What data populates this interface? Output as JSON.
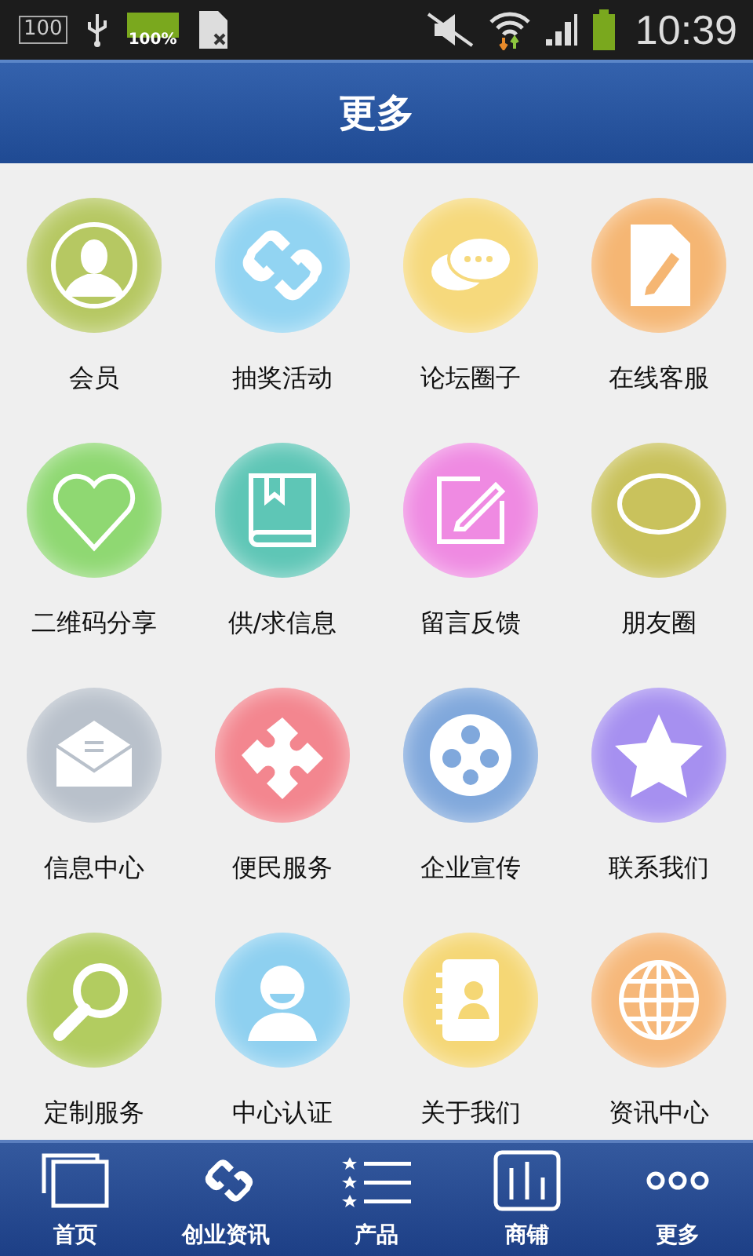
{
  "status_bar": {
    "sd_label": "100",
    "battery_small": "100%",
    "time": "10:39"
  },
  "header": {
    "title": "更多"
  },
  "grid": [
    {
      "label": "会员",
      "kind": "person",
      "color": "#b6c862"
    },
    {
      "label": "抽奖活动",
      "kind": "link",
      "color": "#92d4f2"
    },
    {
      "label": "论坛圈子",
      "kind": "chat",
      "color": "#f6d97c"
    },
    {
      "label": "在线客服",
      "kind": "doc",
      "color": "#f5b673"
    },
    {
      "label": "二维码分享",
      "kind": "heart",
      "color": "#8fd872"
    },
    {
      "label": "供/求信息",
      "kind": "book",
      "color": "#5ec6b6"
    },
    {
      "label": "留言反馈",
      "kind": "note",
      "color": "#ef8ae2"
    },
    {
      "label": "朋友圈",
      "kind": "bubble",
      "color": "#c9c25c"
    },
    {
      "label": "信息中心",
      "kind": "mail",
      "color": "#b9c1cb"
    },
    {
      "label": "便民服务",
      "kind": "puzzle",
      "color": "#f3868f"
    },
    {
      "label": "企业宣传",
      "kind": "film",
      "color": "#80a8dc"
    },
    {
      "label": "联系我们",
      "kind": "star",
      "color": "#a690f0"
    },
    {
      "label": "定制服务",
      "kind": "search",
      "color": "#b2cc60"
    },
    {
      "label": "中心认证",
      "kind": "user",
      "color": "#8ed0f0"
    },
    {
      "label": "关于我们",
      "kind": "contacts",
      "color": "#f5d775"
    },
    {
      "label": "资讯中心",
      "kind": "globe",
      "color": "#f6b87a"
    }
  ],
  "bottom_nav": [
    {
      "label": "首页",
      "kind": "pages"
    },
    {
      "label": "创业资讯",
      "kind": "link"
    },
    {
      "label": "产品",
      "kind": "list"
    },
    {
      "label": "商铺",
      "kind": "chart"
    },
    {
      "label": "更多",
      "kind": "dots"
    }
  ]
}
